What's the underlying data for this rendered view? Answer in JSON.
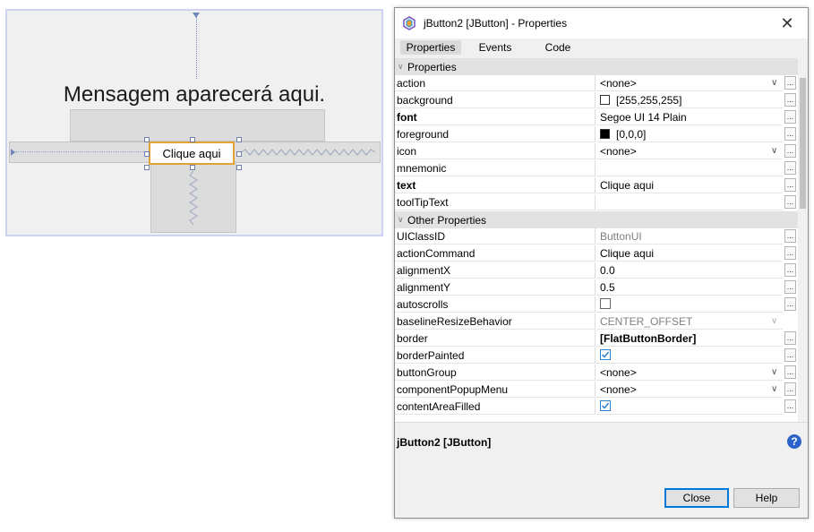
{
  "designer": {
    "message_label": "Mensagem aparecerá aqui.",
    "button_text": "Clique aqui"
  },
  "dialog": {
    "title": "jButton2 [JButton] - Properties",
    "tabs": [
      "Properties",
      "Events",
      "Code"
    ],
    "active_tab": "Properties",
    "sections": [
      {
        "label": "Properties",
        "rows": [
          {
            "name": "action",
            "value": "<none>",
            "bold": false,
            "kind": "dropdown"
          },
          {
            "name": "background",
            "value": "[255,255,255]",
            "bold": false,
            "kind": "color",
            "swatch": "#ffffff"
          },
          {
            "name": "font",
            "value": "Segoe UI 14 Plain",
            "bold": true,
            "kind": "text"
          },
          {
            "name": "foreground",
            "value": "[0,0,0]",
            "bold": false,
            "kind": "color",
            "swatch": "#000000"
          },
          {
            "name": "icon",
            "value": "<none>",
            "bold": false,
            "kind": "dropdown"
          },
          {
            "name": "mnemonic",
            "value": "",
            "bold": false,
            "kind": "text"
          },
          {
            "name": "text",
            "value": "Clique aqui",
            "bold": true,
            "kind": "text"
          },
          {
            "name": "toolTipText",
            "value": "",
            "bold": false,
            "kind": "text"
          }
        ]
      },
      {
        "label": "Other Properties",
        "rows": [
          {
            "name": "UIClassID",
            "value": "ButtonUI",
            "bold": false,
            "kind": "readonly"
          },
          {
            "name": "actionCommand",
            "value": "Clique aqui",
            "bold": false,
            "kind": "text"
          },
          {
            "name": "alignmentX",
            "value": "0.0",
            "bold": false,
            "kind": "text"
          },
          {
            "name": "alignmentY",
            "value": "0.5",
            "bold": false,
            "kind": "text"
          },
          {
            "name": "autoscrolls",
            "value": "",
            "bold": false,
            "kind": "checkbox",
            "checked": false
          },
          {
            "name": "baselineResizeBehavior",
            "value": "CENTER_OFFSET",
            "bold": false,
            "kind": "readonly-dropdown"
          },
          {
            "name": "border",
            "value": "[FlatButtonBorder]",
            "bold": false,
            "kind": "boldvalue"
          },
          {
            "name": "borderPainted",
            "value": "",
            "bold": false,
            "kind": "checkbox",
            "checked": true
          },
          {
            "name": "buttonGroup",
            "value": "<none>",
            "bold": false,
            "kind": "dropdown"
          },
          {
            "name": "componentPopupMenu",
            "value": "<none>",
            "bold": false,
            "kind": "dropdown"
          },
          {
            "name": "contentAreaFilled",
            "value": "",
            "bold": false,
            "kind": "checkbox",
            "checked": true
          }
        ]
      }
    ],
    "description_title": "jButton2 [JButton]",
    "buttons": {
      "close": "Close",
      "help": "Help"
    }
  }
}
